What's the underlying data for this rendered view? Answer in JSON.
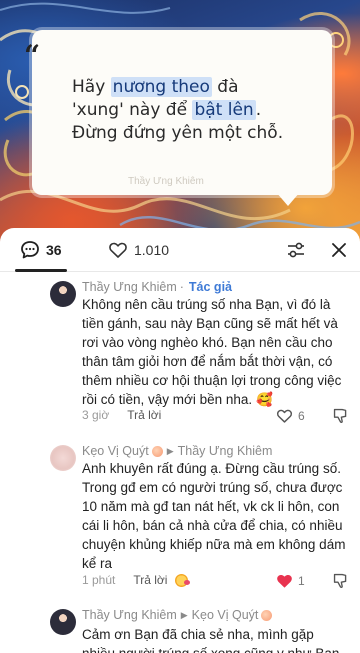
{
  "quote": {
    "mark": "“",
    "line1_pre": "Hãy ",
    "line1_hl": "nương theo",
    "line1_post": " đà",
    "line2_pre": "'xung' này để ",
    "line2_hl": "bật lên",
    "line2_post": ".",
    "line3": "Đừng đứng yên một chỗ.",
    "caption": "Thầy Ưng Khiêm"
  },
  "header": {
    "comment_count": "36",
    "like_count": "1.010"
  },
  "comments": [
    {
      "author": "Thầy Ưng Khiêm",
      "separator": "·",
      "tag": "Tác giả",
      "body": "Không nên cầu trúng số nha Bạn, vì đó là tiền gánh, sau này Bạn cũng sẽ mất hết và rơi vào vòng nghèo khó. Bạn nên cầu cho thân tâm giỏi hơn để nắm bắt thời vận, có thêm nhiều cơ hội thuận lợi trong công việc rồi có tiền, vậy mới bền nha. 🥰",
      "time": "3 giờ",
      "reply_label": "Trả lời",
      "likes": "6"
    },
    {
      "author": "Kẹo Vị Quýt",
      "reply_to": "Thầy Ưng Khiêm",
      "body": "Anh khuyên rất đúng ạ. Đừng cầu trúng số. Trong gđ em có người trúng số, chưa được 10 năm mà gđ tan nát hết, vk ck li hôn, con cái li hôn, bán cả nhà cửa để chia, có nhiều chuyện khủng khiếp nữa mà em không dám kể ra",
      "time": "1 phút",
      "reply_label": "Trả lời",
      "likes": "1"
    },
    {
      "author": "Thầy Ưng Khiêm",
      "reply_to": "Kẹo Vị Quýt",
      "body": "Cảm ơn Bạn đã chia sẻ nha, mình gặp nhiều người trúng số xong cũng y như Bạn nói"
    }
  ],
  "colors": {
    "accent_blue": "#3e7ad6",
    "like_red": "#e8334f",
    "highlight": "#cfe0f7"
  }
}
